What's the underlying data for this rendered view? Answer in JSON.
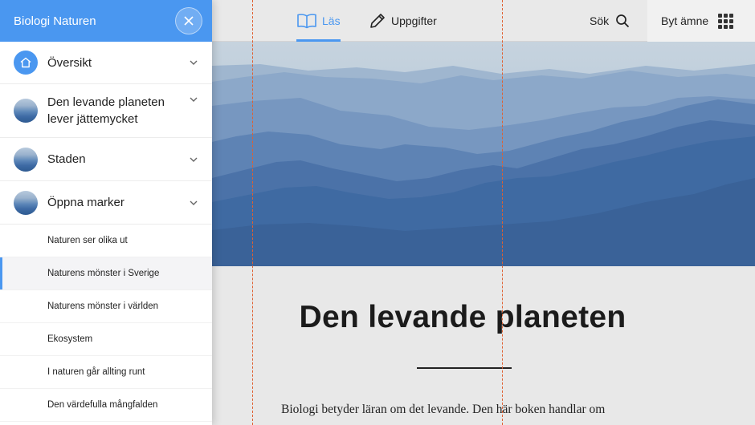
{
  "sidebar": {
    "title": "Biologi Naturen",
    "chapters": [
      {
        "label": "Översikt",
        "icon": "home-icon"
      },
      {
        "label": "Den levande planeten lever jättemycket",
        "icon": "mountain-thumbnail"
      },
      {
        "label": "Staden",
        "icon": "mountain-thumbnail"
      },
      {
        "label": "Öppna marker",
        "icon": "mountain-thumbnail"
      }
    ],
    "subitems": [
      {
        "label": "Naturen ser olika ut"
      },
      {
        "label": "Naturens mönster i Sverige"
      },
      {
        "label": "Naturens mönster i världen"
      },
      {
        "label": "Ekosystem"
      },
      {
        "label": "I naturen går allting runt"
      },
      {
        "label": "Den värdefulla mångfalden"
      }
    ],
    "active_subitem": "Naturens mönster i Sverige"
  },
  "topbar": {
    "tabs": [
      {
        "label": "Läs",
        "icon": "book-icon",
        "active": true
      },
      {
        "label": "Uppgifter",
        "icon": "pencil-icon",
        "active": false
      }
    ],
    "search_label": "Sök",
    "subject_label": "Byt ämne"
  },
  "content": {
    "heading": "Den levande planeten",
    "paragraph": "Biologi betyder läran om det levande. Den här boken handlar om"
  },
  "colors": {
    "accent": "#4a97f0",
    "guide": "#e06030"
  }
}
